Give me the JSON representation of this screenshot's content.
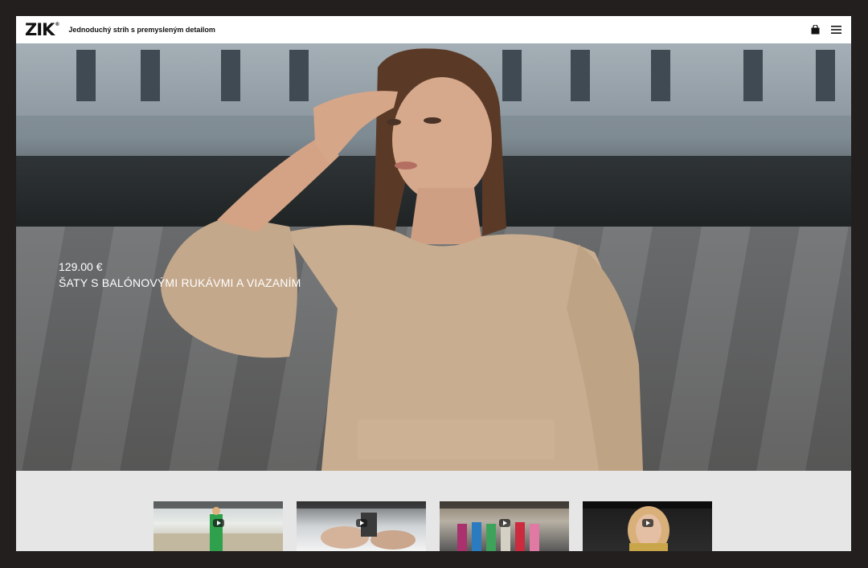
{
  "header": {
    "logo": "ZIK",
    "logo_mark": "®",
    "tagline": "Jednoduchý strih s premysleným detailom",
    "icons": [
      "shopping-bag-icon",
      "menu-icon"
    ]
  },
  "hero": {
    "price": "129.00 €",
    "product_name": "ŠATY S BALÓNOVÝMI RUKÁVMI A VIAZANÍM"
  },
  "videos": [
    {
      "id": "v1"
    },
    {
      "id": "v2"
    },
    {
      "id": "v3"
    },
    {
      "id": "v4"
    }
  ],
  "colors": {
    "page_bg": "#231f1f",
    "header_bg": "#ffffff",
    "content_bg": "#e6e6e6",
    "dress": "#c9ad90"
  }
}
